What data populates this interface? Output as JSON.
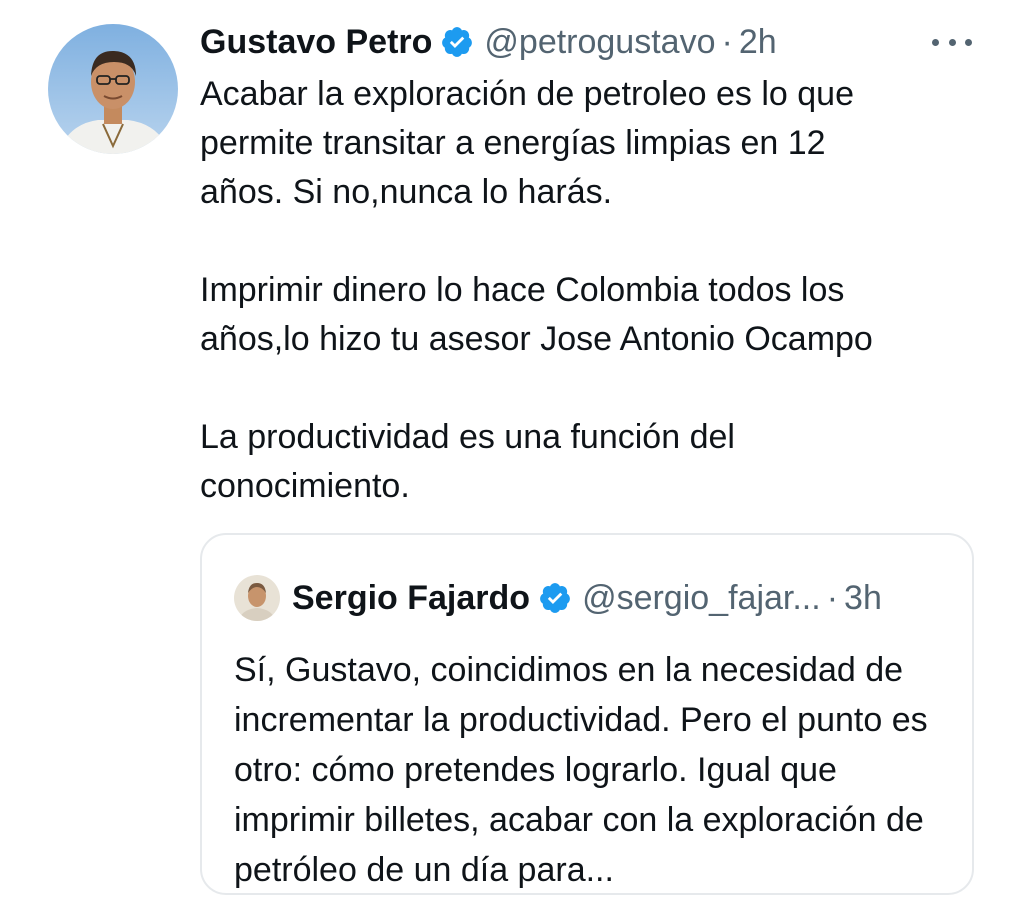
{
  "tweet": {
    "author_name": "Gustavo Petro",
    "handle": "@petrogustavo",
    "separator": "·",
    "time": "2h",
    "paragraphs": [
      "Acabar la exploración de petroleo es lo que\npermite transitar a energías limpias en 12\naños. Si no,nunca lo harás.",
      "Imprimir dinero lo hace Colombia todos los\naños,lo hizo tu asesor Jose Antonio Ocampo",
      "La productividad es una función del\nconocimiento."
    ]
  },
  "quoted_tweet": {
    "author_name": "Sergio Fajardo",
    "handle": "@sergio_fajar...",
    "separator": "·",
    "time": "3h",
    "text": "Sí, Gustavo, coincidimos en la necesidad de incrementar la productividad. Pero el punto es otro: cómo pretendes lograrlo. Igual que imprimir billetes, acabar con la exploración de petróleo de un día para..."
  },
  "icons": {
    "verified": "verified-badge-icon",
    "more": "more-options-icon"
  },
  "colors": {
    "verified_blue": "#1d9bf0",
    "text_primary": "#0f1419",
    "text_secondary": "#536471",
    "card_border": "#e6e9ec"
  }
}
